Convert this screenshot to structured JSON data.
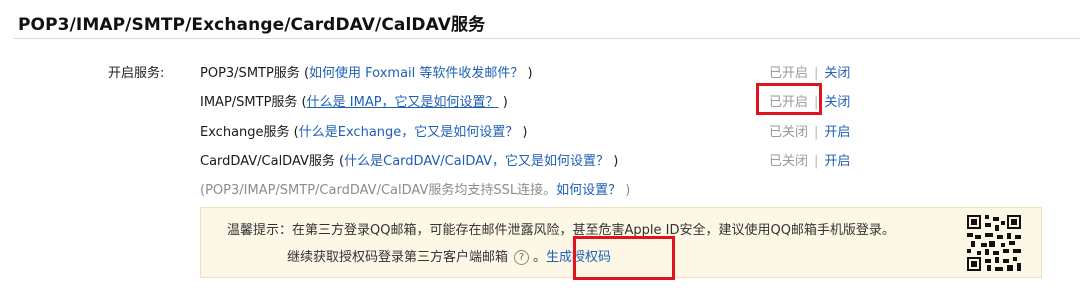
{
  "header": {
    "title": "POP3/IMAP/SMTP/Exchange/CardDAV/CalDAV服务"
  },
  "section": {
    "label": "开启服务:"
  },
  "services": [
    {
      "name": "POP3/SMTP服务",
      "open": " (",
      "link": "如何使用 Foxmail 等软件收发邮件？",
      "close": " )",
      "status": "已开启",
      "sep": "|",
      "action": "关闭"
    },
    {
      "name": "IMAP/SMTP服务",
      "open": " (",
      "link": "什么是 IMAP，它又是如何设置？",
      "close": " )",
      "status": "已开启",
      "sep": "|",
      "action": "关闭"
    },
    {
      "name": "Exchange服务",
      "open": " (",
      "link": "什么是Exchange，它又是如何设置？",
      "close": " )",
      "status": "已关闭",
      "sep": "|",
      "action": "开启"
    },
    {
      "name": "CardDAV/CalDAV服务",
      "open": " (",
      "link": "什么是CardDAV/CalDAV，它又是如何设置？",
      "close": " )",
      "status": "已关闭",
      "sep": "|",
      "action": "开启"
    }
  ],
  "note": {
    "text": "(POP3/IMAP/SMTP/CardDAV/CalDAV服务均支持SSL连接。",
    "link": "如何设置？",
    "close": " )"
  },
  "tip": {
    "prefix": "温馨提示：",
    "line1": "在第三方登录QQ邮箱，可能存在邮件泄露风险，甚至危害Apple ID安全，建议使用QQ邮箱手机版登录。",
    "line2": "继续获取授权码登录第三方客户端邮箱",
    "help_glyph": "?",
    "link": "生成授权码"
  }
}
